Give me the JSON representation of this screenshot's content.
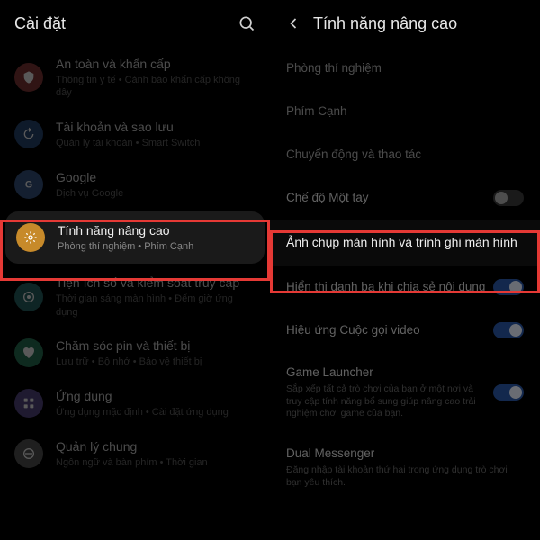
{
  "left": {
    "title": "Cài đặt",
    "items": [
      {
        "title": "An toàn và khẩn cấp",
        "sub": "Thông tin y tế • Cảnh báo khẩn cấp không dây",
        "iconBg": "bg-red",
        "icon": "shield"
      },
      {
        "title": "Tài khoản và sao lưu",
        "sub": "Quản lý tài khoản • Smart Switch",
        "iconBg": "bg-blue",
        "icon": "sync"
      },
      {
        "title": "Google",
        "sub": "Dịch vụ Google",
        "iconBg": "bg-blue2",
        "icon": "g"
      },
      {
        "title": "Tính năng nâng cao",
        "sub": "Phòng thí nghiệm • Phím Cạnh",
        "iconBg": "bg-orange",
        "icon": "gear",
        "highlight": true
      },
      {
        "title": "Tiện ích số và kiểm soát truy cập",
        "sub": "Thời gian sáng màn hình • Đếm giờ ứng dụng",
        "iconBg": "bg-teal",
        "icon": "wellbeing"
      },
      {
        "title": "Chăm sóc pin và thiết bị",
        "sub": "Lưu trữ • Bộ nhớ • Bảo vệ thiết bị",
        "iconBg": "bg-green",
        "icon": "heart"
      },
      {
        "title": "Ứng dụng",
        "sub": "Ứng dụng mặc định • Cài đặt ứng dụng",
        "iconBg": "bg-purple",
        "icon": "apps"
      },
      {
        "title": "Quản lý chung",
        "sub": "Ngôn ngữ và bàn phím • Thời gian",
        "iconBg": "bg-gray",
        "icon": "general"
      }
    ]
  },
  "right": {
    "title": "Tính năng nâng cao",
    "items": [
      {
        "title": "Phòng thí nghiệm"
      },
      {
        "title": "Phím Cạnh"
      },
      {
        "title": "Chuyển động và thao tác"
      },
      {
        "title": "Chế độ Một tay",
        "toggle": "off"
      },
      {
        "title": "Ảnh chụp màn hình và trình ghi màn hình",
        "highlight": true
      },
      {
        "title": "Hiển thị danh bạ khi chia sẻ nội dung",
        "toggle": "on"
      },
      {
        "title": "Hiệu ứng Cuộc gọi video",
        "toggle": "on"
      },
      {
        "title": "Game Launcher",
        "sub": "Sắp xếp tất cả trò chơi của bạn ở một nơi và truy cập tính năng bổ sung giúp nâng cao trải nghiệm chơi game của bạn.",
        "toggle": "on"
      },
      {
        "title": "Dual Messenger",
        "sub": "Đăng nhập tài khoản thứ hai trong ứng dụng trò chơi bạn yêu thích."
      }
    ]
  }
}
